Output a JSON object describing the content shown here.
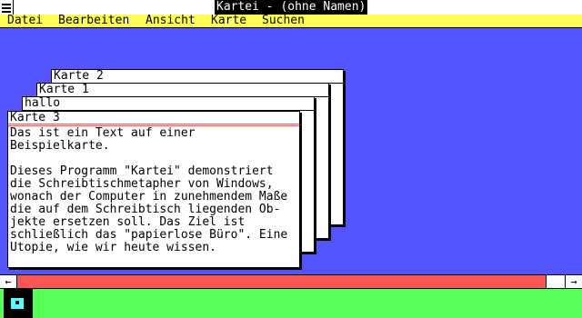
{
  "window": {
    "title": "Kartei - (ohne Namen)"
  },
  "menu": {
    "items": [
      "Datei",
      "Bearbeiten",
      "Ansicht",
      "Karte",
      "Suchen"
    ]
  },
  "cards": [
    {
      "title": "Karte 2"
    },
    {
      "title": "Karte 1"
    },
    {
      "title": "hallo"
    },
    {
      "title": "Karte 3",
      "body": "Das ist ein Text auf einer\nBeispielkarte.\n\nDieses Programm \"Kartei\" demonstriert\ndie Schreibtischmetapher von Windows,\nwonach der Computer in zunehmendem Maße\ndie auf dem Schreibtisch liegenden Ob-\njekte ersetzen soll. Das Ziel ist\nschließlich das \"papierlose Büro\". Eine\nUtopie, wie wir heute wissen."
    }
  ],
  "scrollbar": {
    "left_arrow": "←",
    "right_arrow": "→",
    "position": 0.95
  },
  "icons": {
    "system_menu": "system-menu-icon",
    "disk": "floppy-disk-icon"
  },
  "colors": {
    "desktop": "#5555ff",
    "menubar": "#ffff55",
    "scrollbar": "#ff5555",
    "iconbar": "#55ff55"
  }
}
